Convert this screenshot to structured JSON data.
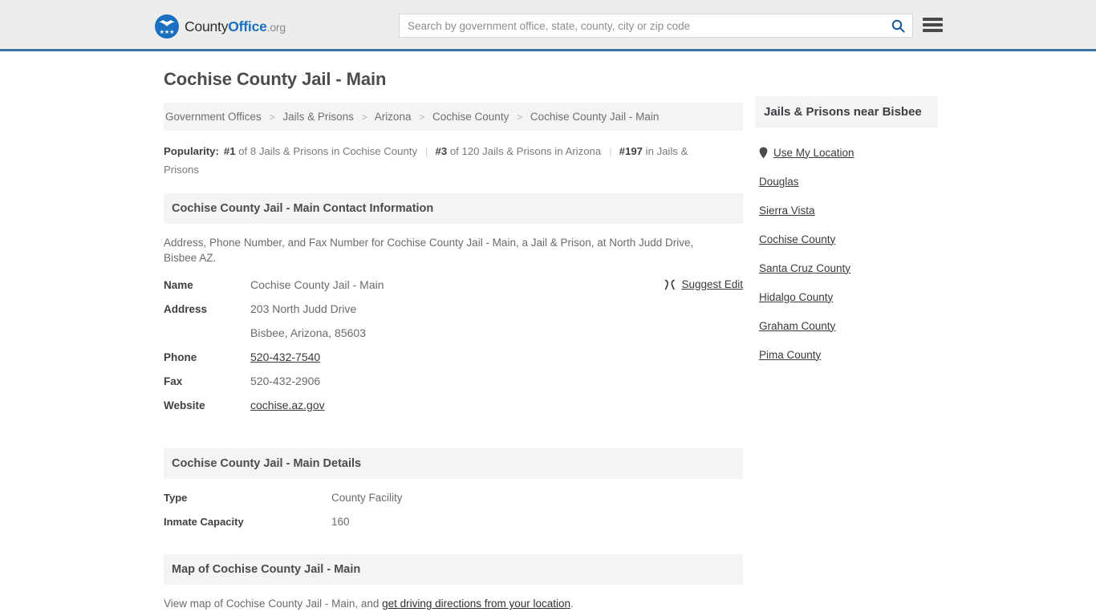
{
  "header": {
    "logo": {
      "part1": "County",
      "part2": "Office",
      "part3": ".org",
      "brand_color": "#1b6fc0"
    },
    "search": {
      "placeholder": "Search by government office, state, county, city or zip code",
      "value": ""
    },
    "accent_border_color": "#3b75a5",
    "background_color": "#eeedeb"
  },
  "main": {
    "title": "Cochise County Jail - Main",
    "breadcrumb": [
      "Government Offices",
      "Jails & Prisons",
      "Arizona",
      "Cochise County",
      "Cochise County Jail - Main"
    ],
    "breadcrumb_separator": ">",
    "popularity": {
      "label": "Popularity:",
      "items": [
        {
          "rank": "#1",
          "text": "of 8 Jails & Prisons in Cochise County"
        },
        {
          "rank": "#3",
          "text": "of 120 Jails & Prisons in Arizona"
        },
        {
          "rank": "#197",
          "text": "in Jails & Prisons"
        }
      ]
    },
    "contact": {
      "heading": "Cochise County Jail - Main Contact Information",
      "description": "Address, Phone Number, and Fax Number for Cochise County Jail - Main, a Jail & Prison, at North Judd Drive, Bisbee AZ.",
      "suggest_edit_label": "Suggest Edit",
      "rows": [
        {
          "label": "Name",
          "value": "Cochise County Jail - Main",
          "link": false
        },
        {
          "label": "Address",
          "value": "203 North Judd Drive",
          "link": false
        },
        {
          "label": "",
          "value": "Bisbee, Arizona, 85603",
          "link": false
        },
        {
          "label": "Phone",
          "value": "520-432-7540",
          "link": true
        },
        {
          "label": "Fax",
          "value": "520-432-2906",
          "link": false
        },
        {
          "label": "Website",
          "value": "cochise.az.gov",
          "link": true
        }
      ]
    },
    "details": {
      "heading": "Cochise County Jail - Main Details",
      "rows": [
        {
          "label": "Type",
          "value": "County Facility"
        },
        {
          "label": "Inmate Capacity",
          "value": "160"
        }
      ]
    },
    "map": {
      "heading": "Map of Cochise County Jail - Main",
      "text_before": "View map of Cochise County Jail - Main, and ",
      "link_text": "get driving directions from your location",
      "text_after": "."
    }
  },
  "sidebar": {
    "heading": "Jails & Prisons near Bisbee",
    "items": [
      {
        "label": "Use My Location",
        "icon": "map-pin-icon"
      },
      {
        "label": "Douglas",
        "icon": ""
      },
      {
        "label": "Sierra Vista",
        "icon": ""
      },
      {
        "label": "Cochise County",
        "icon": ""
      },
      {
        "label": "Santa Cruz County",
        "icon": ""
      },
      {
        "label": "Hidalgo County",
        "icon": ""
      },
      {
        "label": "Graham County",
        "icon": ""
      },
      {
        "label": "Pima County",
        "icon": ""
      }
    ]
  }
}
